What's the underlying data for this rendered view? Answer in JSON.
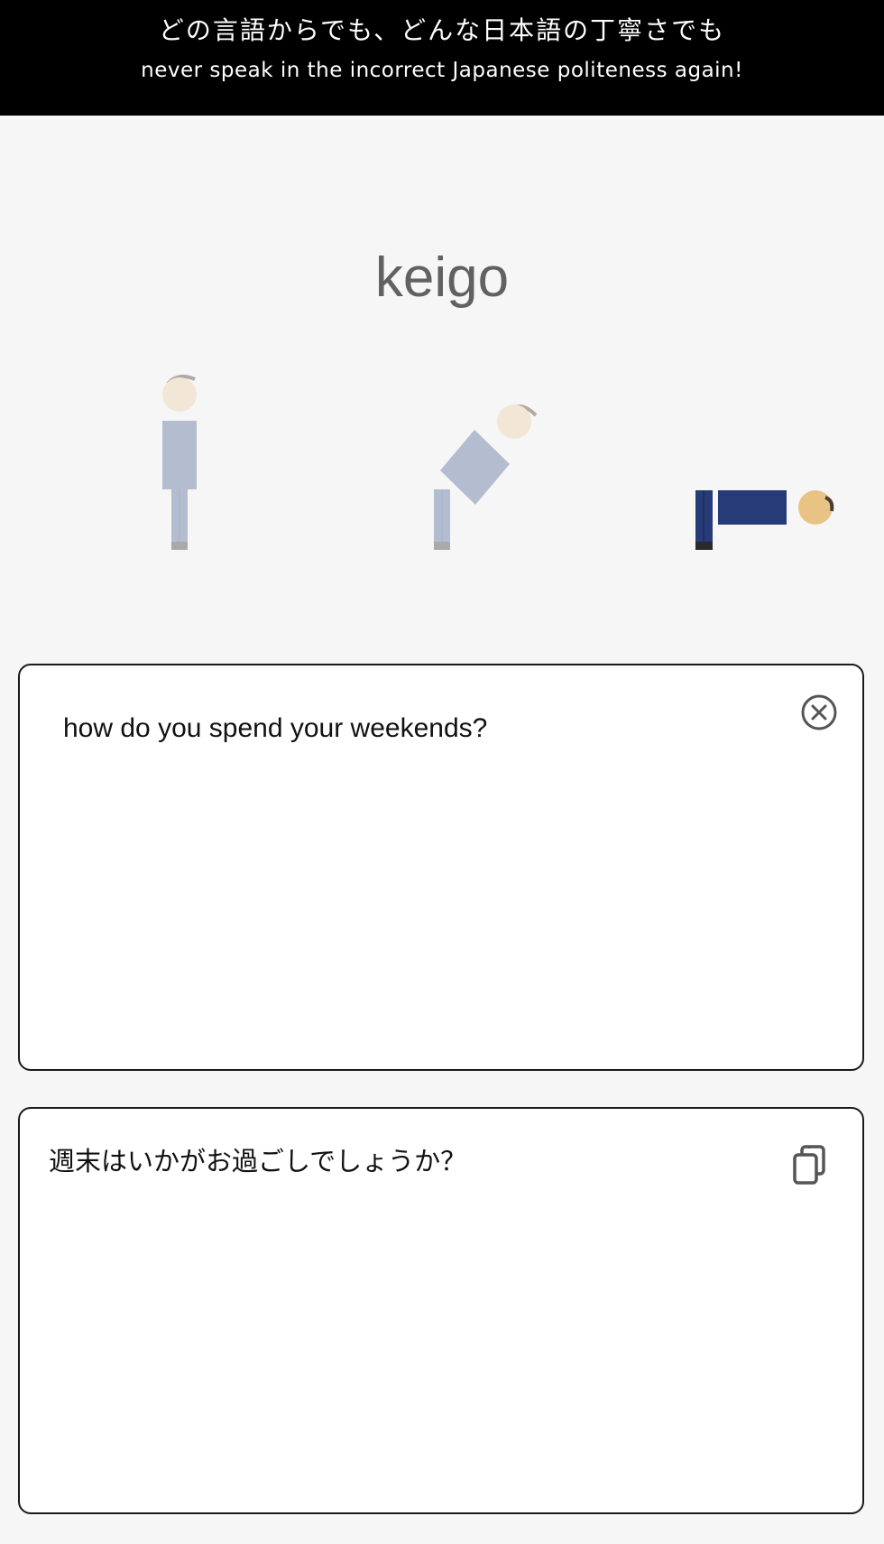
{
  "banner": {
    "tagline_ja": "どの言語からでも、どんな日本語の丁寧さでも",
    "tagline_en": "never speak in the incorrect Japanese politeness again!"
  },
  "app": {
    "title": "keigo"
  },
  "bow_figures": [
    {
      "name": "standing",
      "shirt_color": "#b4bccf",
      "level": "casual"
    },
    {
      "name": "leaning",
      "shirt_color": "#b4bccf",
      "level": "polite"
    },
    {
      "name": "deep-bow",
      "shirt_color": "#263b78",
      "level": "honorific",
      "selected": true
    }
  ],
  "input": {
    "value": "how do you spend your weekends?",
    "clear_icon": "close-circle-icon"
  },
  "output": {
    "value": "週末はいかがお過ごしでしょうか？",
    "copy_icon": "copy-icon"
  },
  "colors": {
    "banner_bg": "#000000",
    "page_bg": "#f6f6f6",
    "title": "#616161",
    "selected_suit": "#263b78",
    "inactive_suit": "#b4bccf"
  }
}
